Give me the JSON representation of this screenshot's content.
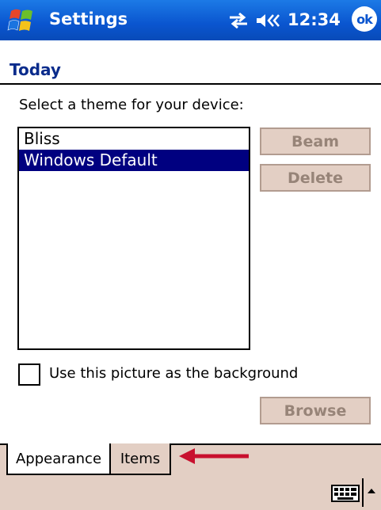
{
  "titlebar": {
    "app_title": "Settings",
    "clock": "12:34",
    "ok_label": "ok",
    "icons": [
      "windows-start-icon",
      "connectivity-icon",
      "volume-icon"
    ],
    "colors": {
      "titlebar": "#0a55cf",
      "selection": "#000080",
      "panel": "#e3cfc4",
      "arrow": "#c8102e"
    }
  },
  "page": {
    "title": "Today",
    "prompt": "Select a theme for your device:"
  },
  "themes": {
    "items": [
      "Bliss",
      "Windows Default"
    ],
    "selected": "Windows Default"
  },
  "buttons": {
    "beam": "Beam",
    "delete": "Delete",
    "browse": "Browse"
  },
  "background_option": {
    "label": "Use this picture as the background",
    "checked": false
  },
  "tabs": [
    {
      "label": "Appearance",
      "active": true
    },
    {
      "label": "Items",
      "active": false
    }
  ],
  "menubar": {
    "icons": [
      "keyboard-icon",
      "sip-up-arrow-icon"
    ]
  }
}
